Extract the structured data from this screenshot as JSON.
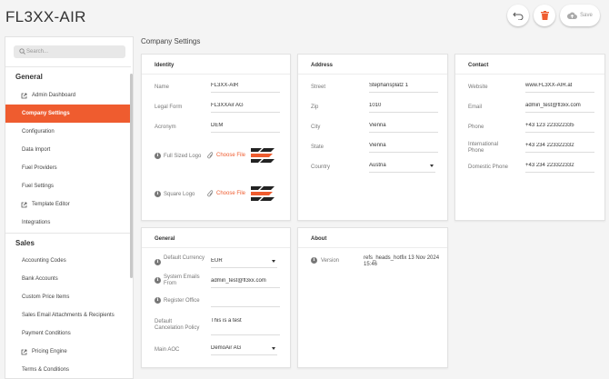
{
  "header": {
    "title": "FL3XX-AIR",
    "save_label": "Save"
  },
  "sidebar": {
    "search_placeholder": "Search...",
    "sections": [
      {
        "title": "General"
      },
      {
        "title": "Sales"
      }
    ],
    "general_items": [
      {
        "label": "Admin Dashboard",
        "external": true
      },
      {
        "label": "Company Settings",
        "active": true
      },
      {
        "label": "Configuration"
      },
      {
        "label": "Data Import"
      },
      {
        "label": "Fuel Providers"
      },
      {
        "label": "Fuel Settings"
      },
      {
        "label": "Template Editor",
        "external": true
      },
      {
        "label": "Integrations"
      }
    ],
    "sales_items": [
      {
        "label": "Accounting Codes"
      },
      {
        "label": "Bank Accounts"
      },
      {
        "label": "Custom Price Items"
      },
      {
        "label": "Sales Email Attachments & Recipients"
      },
      {
        "label": "Payment Conditions"
      },
      {
        "label": "Pricing Engine",
        "external": true
      },
      {
        "label": "Terms & Conditions"
      }
    ]
  },
  "page": {
    "title": "Company Settings"
  },
  "identity": {
    "heading": "Identity",
    "name_label": "Name",
    "name_value": "FL3XX-AIR",
    "legal_label": "Legal Form",
    "legal_value": "FL3XXAir AG",
    "acronym_label": "Acronym",
    "acronym_value": "DEM",
    "full_logo_label": "Full Sized Logo",
    "square_logo_label": "Square Logo",
    "choose_file": "Choose File"
  },
  "address": {
    "heading": "Address",
    "street_label": "Street",
    "street_value": "Stephansplatz 1",
    "zip_label": "Zip",
    "zip_value": "1010",
    "city_label": "City",
    "city_value": "Vienna",
    "state_label": "State",
    "state_value": "Vienna",
    "country_label": "Country",
    "country_value": "Austria"
  },
  "contact": {
    "heading": "Contact",
    "website_label": "Website",
    "website_value": "www.FL3XX-AIR.at",
    "email_label": "Email",
    "email_value": "admin_test@fl3xx.com",
    "phone_label": "Phone",
    "phone_value": "+43 123 223322335",
    "intl_label": "International Phone",
    "intl_value": "+43 234 223322332",
    "domestic_label": "Domestic Phone",
    "domestic_value": "+43 234 223322332"
  },
  "general": {
    "heading": "General",
    "currency_label": "Default Currency",
    "currency_value": "EUR",
    "emails_label": "System Emails From",
    "emails_value": "admin_test@fl3xx.com",
    "register_label": "Register Office",
    "register_value": "",
    "cancel_label": "Default Cancelation Policy",
    "cancel_value": "This is a test",
    "aoc_label": "Main AOC",
    "aoc_value": "DemoAir AG"
  },
  "about": {
    "heading": "About",
    "version_label": "Version",
    "version_value": "refs_heads_hotfix 13 Nov 2024 15:46"
  },
  "colors": {
    "accent": "#ef5c2f"
  }
}
